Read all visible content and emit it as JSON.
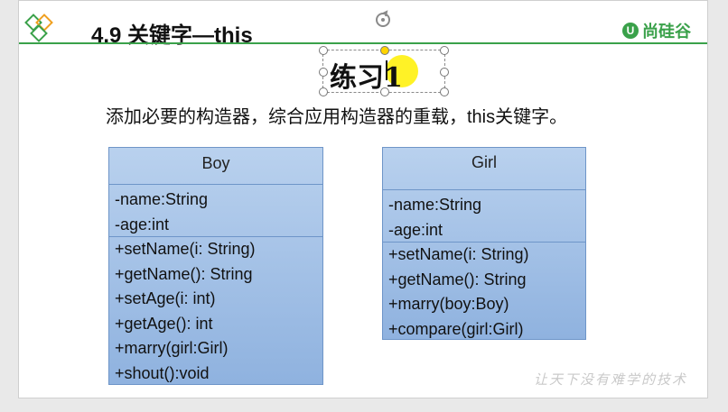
{
  "header": {
    "title": "4.9  关键字—this",
    "brand": "尚硅谷",
    "brand_icon": "U"
  },
  "exercise": {
    "title": "练习1",
    "instruction": "添加必要的构造器，综合应用构造器的重载，this关键字。"
  },
  "classes": {
    "boy": {
      "name": "Boy",
      "attributes": [
        "-name:String",
        "-age:int"
      ],
      "methods": [
        "+setName(i: String)",
        "+getName(): String",
        "+setAge(i: int)",
        "+getAge(): int",
        "+marry(girl:Girl)",
        "+shout():void"
      ]
    },
    "girl": {
      "name": "Girl",
      "attributes": [
        "-name:String",
        "-age:int"
      ],
      "methods": [
        "+setName(i: String)",
        "+getName(): String",
        "+marry(boy:Boy)",
        "+compare(girl:Girl)"
      ]
    }
  },
  "footer": {
    "watermark": "让天下没有难学的技术"
  },
  "colors": {
    "accent": "#3aa14a",
    "uml_fill": "#a8c4ea",
    "highlight": "#fff000"
  }
}
